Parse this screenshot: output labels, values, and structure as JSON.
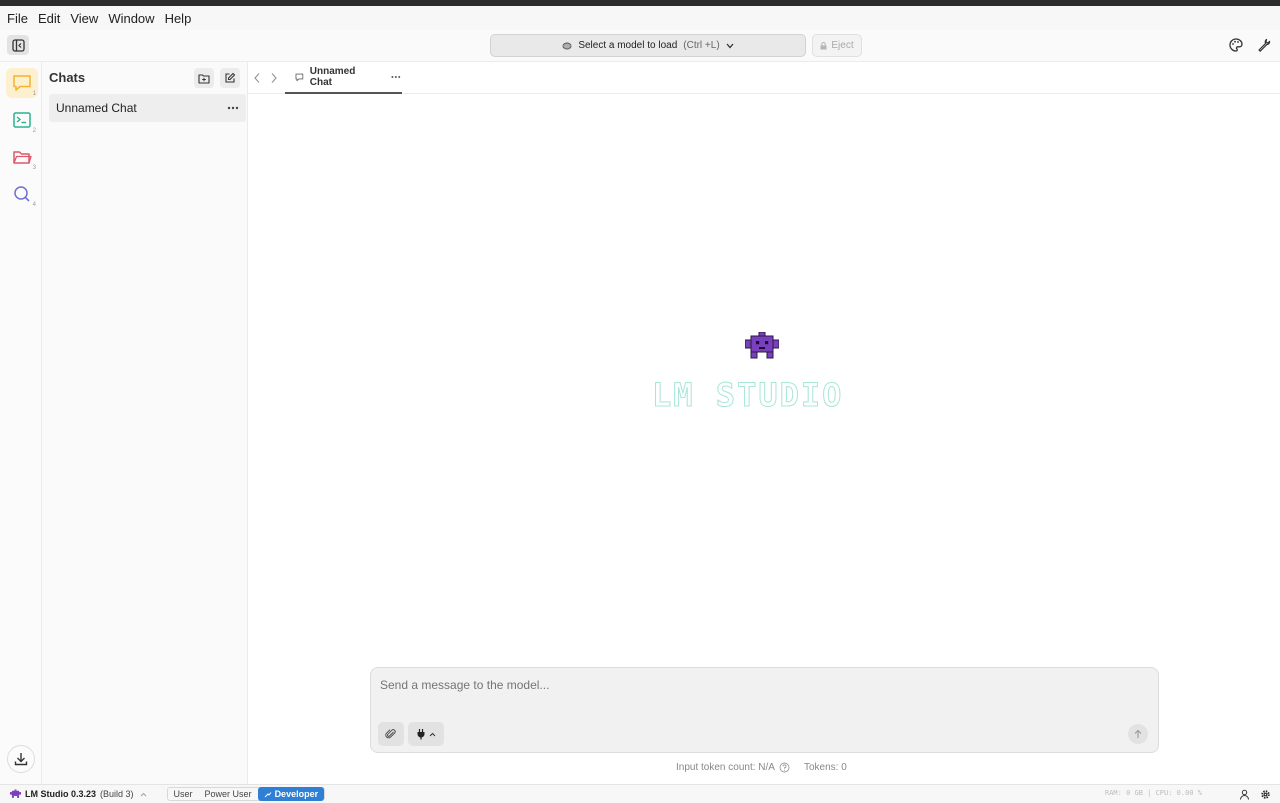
{
  "menu": [
    "File",
    "Edit",
    "View",
    "Window",
    "Help"
  ],
  "toolbar": {
    "model_select_label": "Select a model to load",
    "model_select_shortcut": "(Ctrl +L)",
    "eject_label": "Eject"
  },
  "rail": {
    "badges": [
      "1",
      "2",
      "3",
      "4"
    ]
  },
  "sidebar": {
    "title": "Chats",
    "chats": [
      {
        "label": "Unnamed Chat"
      }
    ]
  },
  "tabs": [
    {
      "label": "Unnamed Chat"
    }
  ],
  "composer": {
    "placeholder": "Send a message to the model..."
  },
  "footer": {
    "token_count_label": "Input token count: N/A",
    "tokens_label": "Tokens: 0"
  },
  "statusbar": {
    "app_name": "LM Studio 0.3.23",
    "build": "(Build 3)",
    "modes": [
      "User",
      "Power User",
      "Developer"
    ],
    "sys_stats": "RAM: 0 GB | CPU: 0.00 %"
  },
  "logo_text": "LM STUDIO",
  "colors": {
    "accent": "#2f7fd4",
    "chat_icon": "#f2b431",
    "terminal_icon": "#27b38f",
    "folder_icon": "#e0566a",
    "search_icon": "#6f6fd6",
    "mascot": "#7a3fbf"
  }
}
